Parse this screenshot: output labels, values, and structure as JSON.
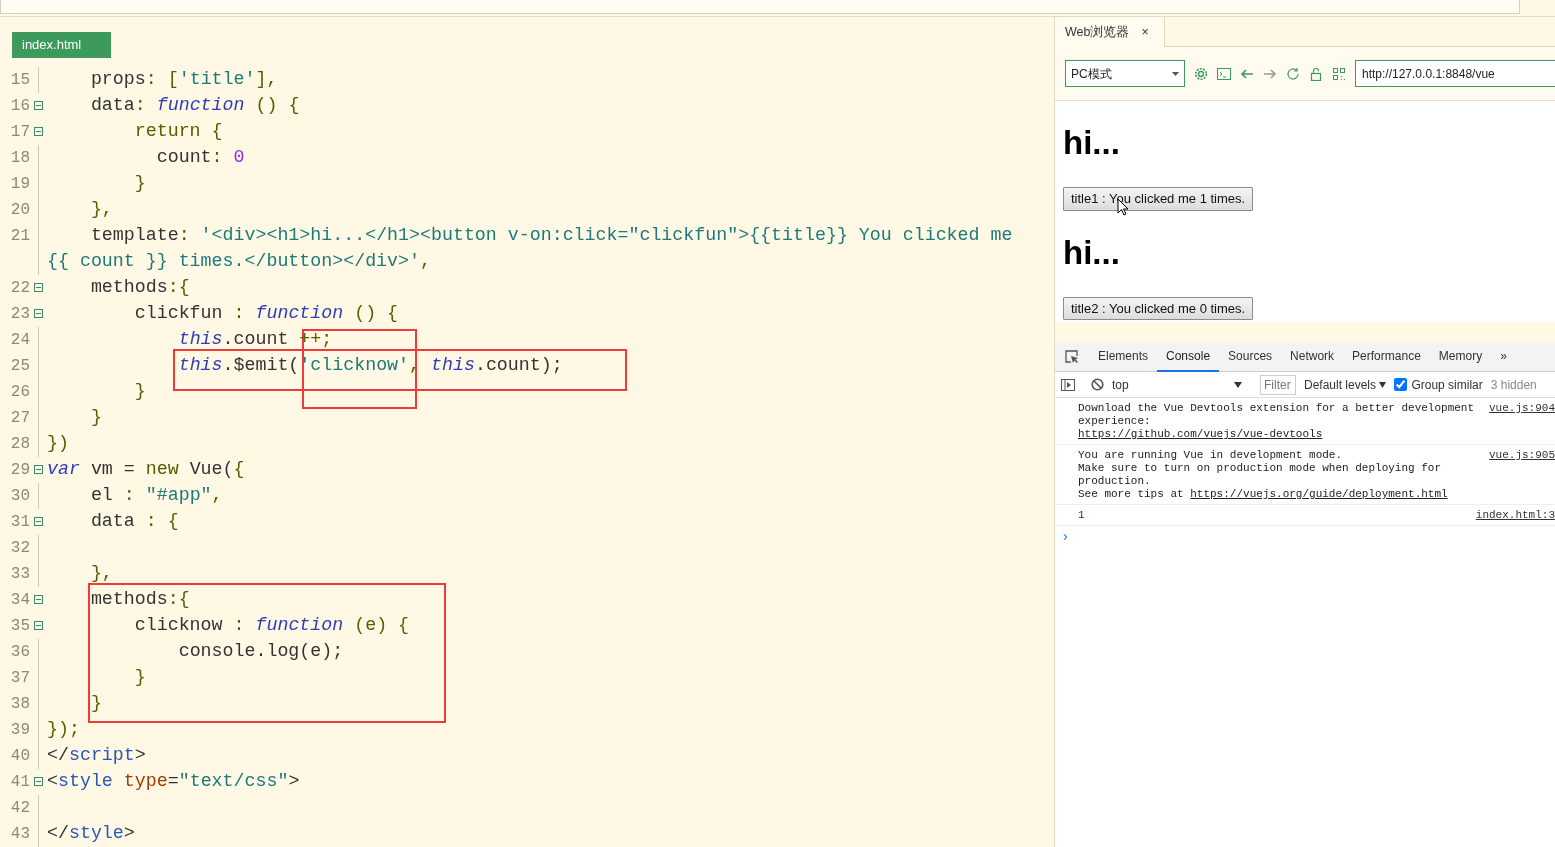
{
  "editor": {
    "tab": "index.html",
    "lines": [
      {
        "number": "15",
        "fold": false,
        "tokens": [
          {
            "kind": "plain",
            "text": "    props"
          },
          {
            "kind": "punct",
            "text": ": "
          },
          {
            "kind": "punct",
            "text": "["
          },
          {
            "kind": "string",
            "text": "'title'"
          },
          {
            "kind": "punct",
            "text": "],"
          }
        ]
      },
      {
        "number": "16",
        "fold": true,
        "tokens": [
          {
            "kind": "plain",
            "text": "    data"
          },
          {
            "kind": "punct",
            "text": ": "
          },
          {
            "kind": "keyword",
            "text": "function"
          },
          {
            "kind": "punct",
            "text": " () {"
          }
        ]
      },
      {
        "number": "17",
        "fold": true,
        "tokens": [
          {
            "kind": "punct",
            "text": "        return {"
          }
        ]
      },
      {
        "number": "18",
        "fold": false,
        "tokens": [
          {
            "kind": "plain",
            "text": "          count"
          },
          {
            "kind": "punct",
            "text": ": "
          },
          {
            "kind": "number",
            "text": "0"
          }
        ]
      },
      {
        "number": "19",
        "fold": false,
        "tokens": [
          {
            "kind": "punct",
            "text": "        }"
          }
        ]
      },
      {
        "number": "20",
        "fold": false,
        "tokens": [
          {
            "kind": "punct",
            "text": "    },"
          }
        ]
      },
      {
        "number": "21",
        "fold": false,
        "tokens": [
          {
            "kind": "plain",
            "text": "    template"
          },
          {
            "kind": "punct",
            "text": ": "
          },
          {
            "kind": "string",
            "text": "'<div><h1>hi...</h1><button v-on:click=\"clickfun\">{{title}} You clicked me"
          }
        ]
      },
      {
        "fold": false,
        "tokens": [
          {
            "kind": "string",
            "text": "{{ count }} times.</button></div>'"
          },
          {
            "kind": "punct",
            "text": ","
          }
        ]
      },
      {
        "number": "22",
        "fold": true,
        "tokens": [
          {
            "kind": "plain",
            "text": "    methods"
          },
          {
            "kind": "punct",
            "text": ":{"
          }
        ]
      },
      {
        "number": "23",
        "fold": true,
        "tokens": [
          {
            "kind": "plain",
            "text": "        clickfun "
          },
          {
            "kind": "punct",
            "text": ": "
          },
          {
            "kind": "keyword",
            "text": "function"
          },
          {
            "kind": "punct",
            "text": " () {"
          }
        ]
      },
      {
        "number": "24",
        "fold": false,
        "tokens": [
          {
            "kind": "keyword",
            "text": "            this"
          },
          {
            "kind": "plain",
            "text": ".count "
          },
          {
            "kind": "punct",
            "text": "++;"
          }
        ]
      },
      {
        "number": "25",
        "fold": false,
        "tokens": [
          {
            "kind": "keyword",
            "text": "            this"
          },
          {
            "kind": "plain",
            "text": ".$emit("
          },
          {
            "kind": "string",
            "text": "'clicknow'"
          },
          {
            "kind": "punct",
            "text": ", "
          },
          {
            "kind": "keyword",
            "text": "this"
          },
          {
            "kind": "plain",
            "text": ".count);"
          }
        ]
      },
      {
        "number": "26",
        "fold": false,
        "tokens": [
          {
            "kind": "punct",
            "text": "        }"
          }
        ]
      },
      {
        "number": "27",
        "fold": false,
        "tokens": [
          {
            "kind": "punct",
            "text": "    }"
          }
        ]
      },
      {
        "number": "28",
        "fold": false,
        "tokens": [
          {
            "kind": "punct",
            "text": "})"
          }
        ]
      },
      {
        "number": "29",
        "fold": true,
        "tokens": [
          {
            "kind": "keyword",
            "text": "var"
          },
          {
            "kind": "plain",
            "text": " vm = "
          },
          {
            "kind": "punct",
            "text": "new"
          },
          {
            "kind": "plain",
            "text": " Vue("
          },
          {
            "kind": "punct",
            "text": "{"
          }
        ]
      },
      {
        "number": "30",
        "fold": false,
        "tokens": [
          {
            "kind": "plain",
            "text": "    el "
          },
          {
            "kind": "punct",
            "text": ": "
          },
          {
            "kind": "string",
            "text": "\"#app\""
          },
          {
            "kind": "punct",
            "text": ","
          }
        ]
      },
      {
        "number": "31",
        "fold": true,
        "tokens": [
          {
            "kind": "plain",
            "text": "    data "
          },
          {
            "kind": "punct",
            "text": ": {"
          }
        ]
      },
      {
        "number": "32",
        "fold": false
      },
      {
        "number": "33",
        "fold": false,
        "tokens": [
          {
            "kind": "punct",
            "text": "    },"
          }
        ]
      },
      {
        "number": "34",
        "fold": true,
        "tokens": [
          {
            "kind": "plain",
            "text": "    methods"
          },
          {
            "kind": "punct",
            "text": ":{"
          }
        ]
      },
      {
        "number": "35",
        "fold": true,
        "tokens": [
          {
            "kind": "plain",
            "text": "        clicknow "
          },
          {
            "kind": "punct",
            "text": ": "
          },
          {
            "kind": "keyword",
            "text": "function"
          },
          {
            "kind": "punct",
            "text": " (e) {"
          }
        ]
      },
      {
        "number": "36",
        "fold": false,
        "tokens": [
          {
            "kind": "plain",
            "text": "            console.log(e);"
          }
        ]
      },
      {
        "number": "37",
        "fold": false,
        "tokens": [
          {
            "kind": "punct",
            "text": "        }"
          }
        ]
      },
      {
        "number": "38",
        "fold": false,
        "tokens": [
          {
            "kind": "punct",
            "text": "    }"
          }
        ]
      },
      {
        "number": "39",
        "fold": false,
        "tokens": [
          {
            "kind": "punct",
            "text": "});"
          }
        ]
      },
      {
        "number": "40",
        "fold": false,
        "tokens": [
          {
            "kind": "plain",
            "text": "</"
          },
          {
            "kind": "tag",
            "text": "script"
          },
          {
            "kind": "plain",
            "text": ">"
          }
        ]
      },
      {
        "number": "41",
        "fold": true,
        "tokens": [
          {
            "kind": "plain",
            "text": "<"
          },
          {
            "kind": "tag",
            "text": "style"
          },
          {
            "kind": "attr",
            "text": " type"
          },
          {
            "kind": "plain",
            "text": "="
          },
          {
            "kind": "string",
            "text": "\"text/css\""
          },
          {
            "kind": "plain",
            "text": ">"
          }
        ]
      },
      {
        "number": "42",
        "fold": false
      },
      {
        "number": "43",
        "fold": false,
        "tokens": [
          {
            "kind": "plain",
            "text": "</"
          },
          {
            "kind": "tag",
            "text": "style"
          },
          {
            "kind": "plain",
            "text": ">"
          }
        ]
      }
    ]
  },
  "browser": {
    "tabs": [
      {
        "label": "Web浏览器",
        "close": "×",
        "selected": true
      }
    ],
    "mode": "PC模式",
    "url": "http://127.0.0.1:8848/vue",
    "page": [
      {
        "kind": "heading",
        "text": "hi..."
      },
      {
        "kind": "button",
        "text": "title1 : You clicked me 1 times."
      },
      {
        "kind": "heading",
        "text": "hi..."
      },
      {
        "kind": "button",
        "text": "title2 : You clicked me 0 times."
      }
    ]
  },
  "devtools": {
    "tabs": [
      {
        "label": "Elements",
        "selected": false
      },
      {
        "label": "Console",
        "selected": true
      },
      {
        "label": "Sources",
        "selected": false
      },
      {
        "label": "Network",
        "selected": false
      },
      {
        "label": "Performance",
        "selected": false
      },
      {
        "label": "Memory",
        "selected": false
      }
    ],
    "more": "»",
    "context": "top",
    "filter_placeholder": "Filter",
    "levels": "Default levels",
    "group_similar": {
      "label": "Group similar",
      "checked": true
    },
    "hidden": "3 hidden",
    "messages": [
      {
        "kind": "text",
        "lines": [
          "Download the Vue Devtools extension for a better development",
          "experience:"
        ],
        "link": "https://github.com/vuejs/vue-devtools",
        "source": "vue.js:904"
      },
      {
        "kind": "text",
        "lines": [
          "You are running Vue in development mode.",
          "Make sure to turn on production mode when deploying for production."
        ],
        "link_prefix": "See more tips at ",
        "link": "https://vuejs.org/guide/deployment.html",
        "source": "vue.js:905"
      },
      {
        "kind": "number",
        "lines": [
          "1"
        ],
        "source": "index.html:3"
      }
    ],
    "prompt": "›"
  }
}
